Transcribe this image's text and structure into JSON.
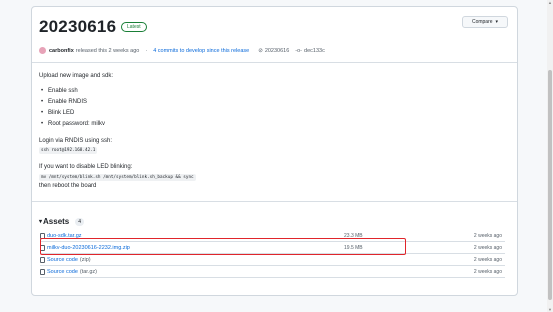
{
  "release": {
    "title": "20230616",
    "badge": "Latest",
    "compare_label": "Compare",
    "author": "carbonfix",
    "released_text": "released this 2 weeks ago",
    "commits_text": "4 commits to develop since this release",
    "tag": "20230616",
    "commit": "dec133c"
  },
  "notes": {
    "intro": "Upload new image and sdk:",
    "items": [
      "Enable ssh",
      "Enable RNDIS",
      "Blink LED",
      "Root password: milkv"
    ],
    "login_text": "Login via RNDIS using ssh:",
    "login_cmd": "ssh root@192.168.42.1",
    "disable_text": "If you want to disable LED blinking:",
    "disable_cmd": "mv /mnt/system/blink.sh /mnt/system/blink.sh_backup && sync",
    "reboot_text": "then reboot the board"
  },
  "assets": {
    "heading": "Assets",
    "count": "4",
    "items": [
      {
        "name": "duo-sdk.tar.gz",
        "sub": "",
        "size": "23.3 MB",
        "date": "2 weeks ago",
        "icon": "package-icon"
      },
      {
        "name": "milkv-duo-20230616-2232.img.zip",
        "sub": "",
        "size": "19.5 MB",
        "date": "2 weeks ago",
        "icon": "package-icon"
      },
      {
        "name": "Source code",
        "sub": "(zip)",
        "size": "",
        "date": "2 weeks ago",
        "icon": "file-zip-icon"
      },
      {
        "name": "Source code",
        "sub": "(tar.gz)",
        "size": "",
        "date": "2 weeks ago",
        "icon": "file-zip-icon"
      }
    ]
  },
  "colors": {
    "link": "#0969da",
    "highlight": "#e0252b",
    "latest": "#1a7f37"
  }
}
